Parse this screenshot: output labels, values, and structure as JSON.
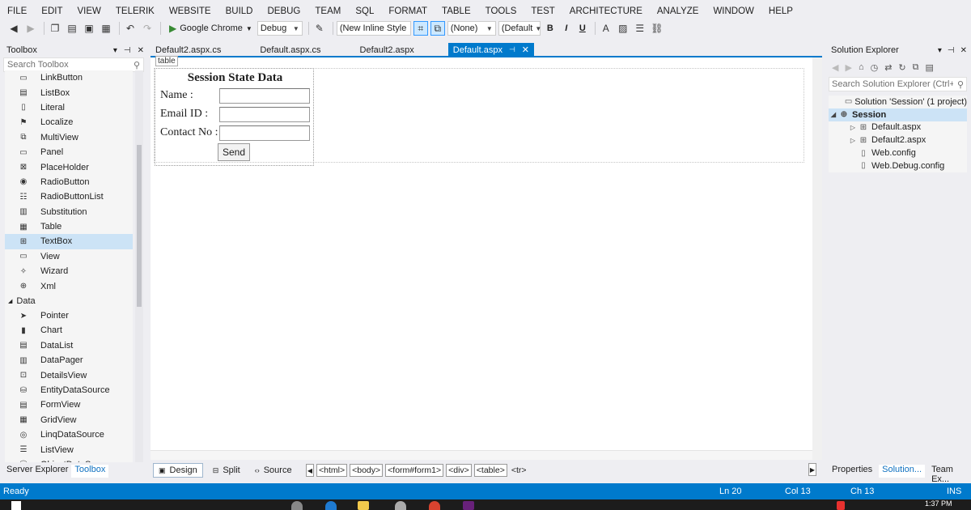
{
  "menu": [
    "FILE",
    "EDIT",
    "VIEW",
    "TELERIK",
    "WEBSITE",
    "BUILD",
    "DEBUG",
    "TEAM",
    "SQL",
    "FORMAT",
    "TABLE",
    "TOOLS",
    "TEST",
    "ARCHITECTURE",
    "ANALYZE",
    "WINDOW",
    "HELP"
  ],
  "toolbar": {
    "run_label": "Google Chrome",
    "config": "Debug",
    "style_combo": "(New Inline Style",
    "target_combo": "(None)",
    "font_combo": "(Default",
    "bold": "B",
    "italic": "I",
    "underline": "U"
  },
  "toolbox": {
    "title": "Toolbox",
    "search_placeholder": "Search Toolbox",
    "items": [
      {
        "label": "LinkButton",
        "icon": "link-button-icon"
      },
      {
        "label": "ListBox",
        "icon": "listbox-icon"
      },
      {
        "label": "Literal",
        "icon": "literal-icon"
      },
      {
        "label": "Localize",
        "icon": "localize-icon"
      },
      {
        "label": "MultiView",
        "icon": "multiview-icon"
      },
      {
        "label": "Panel",
        "icon": "panel-icon"
      },
      {
        "label": "PlaceHolder",
        "icon": "placeholder-icon"
      },
      {
        "label": "RadioButton",
        "icon": "radio-button-icon"
      },
      {
        "label": "RadioButtonList",
        "icon": "radio-list-icon"
      },
      {
        "label": "Substitution",
        "icon": "substitution-icon"
      },
      {
        "label": "Table",
        "icon": "table-icon"
      },
      {
        "label": "TextBox",
        "icon": "textbox-icon"
      },
      {
        "label": "View",
        "icon": "view-icon"
      },
      {
        "label": "Wizard",
        "icon": "wizard-icon"
      },
      {
        "label": "Xml",
        "icon": "xml-icon"
      }
    ],
    "group_label": "Data",
    "data_items": [
      {
        "label": "Pointer",
        "icon": "pointer-icon"
      },
      {
        "label": "Chart",
        "icon": "chart-icon"
      },
      {
        "label": "DataList",
        "icon": "datalist-icon"
      },
      {
        "label": "DataPager",
        "icon": "datapager-icon"
      },
      {
        "label": "DetailsView",
        "icon": "detailsview-icon"
      },
      {
        "label": "EntityDataSource",
        "icon": "entity-datasource-icon"
      },
      {
        "label": "FormView",
        "icon": "formview-icon"
      },
      {
        "label": "GridView",
        "icon": "gridview-icon"
      },
      {
        "label": "LinqDataSource",
        "icon": "linq-datasource-icon"
      },
      {
        "label": "ListView",
        "icon": "listview-icon"
      },
      {
        "label": "ObjectDataSource",
        "icon": "object-datasource-icon"
      }
    ],
    "selected": "TextBox",
    "bottom_tabs": [
      "Server Explorer",
      "Toolbox"
    ]
  },
  "doc_tabs": [
    "Default2.aspx.cs",
    "Default.aspx.cs",
    "Default2.aspx",
    "Default.aspx"
  ],
  "designer": {
    "tag_label": "table",
    "form_title": "Session State Data",
    "labels": [
      "Name :",
      "Email ID :",
      "Contact No :"
    ],
    "send_label": "Send"
  },
  "view_tabs": [
    "Design",
    "Split",
    "Source"
  ],
  "breadcrumbs": [
    "<html>",
    "<body>",
    "<form#form1>",
    "<div>",
    "<table>",
    "<tr>"
  ],
  "solution": {
    "title": "Solution Explorer",
    "search_placeholder": "Search Solution Explorer (Ctrl+;)",
    "tree": [
      {
        "label": "Solution 'Session' (1 project)",
        "indent": 1,
        "expander": "",
        "icon": "solution-icon"
      },
      {
        "label": "Session",
        "indent": 0,
        "expander": "◢",
        "icon": "globe-icon"
      },
      {
        "label": "Default.aspx",
        "indent": 2,
        "expander": "▷",
        "icon": "aspx-file-icon"
      },
      {
        "label": "Default2.aspx",
        "indent": 2,
        "expander": "▷",
        "icon": "aspx-file-icon"
      },
      {
        "label": "Web.config",
        "indent": 2,
        "expander": "",
        "icon": "config-file-icon"
      },
      {
        "label": "Web.Debug.config",
        "indent": 2,
        "expander": "",
        "icon": "config-file-icon"
      }
    ],
    "bottom_tabs": [
      "Properties",
      "Solution...",
      "Team Ex..."
    ]
  },
  "status": {
    "text": "Ready",
    "ln": "Ln 20",
    "col": "Col 13",
    "ch": "Ch 13",
    "mode": "INS"
  },
  "taskbar": {
    "clock": "1:37 PM"
  },
  "colors": {
    "accent": "#007acc",
    "selection": "#cce3f6"
  }
}
